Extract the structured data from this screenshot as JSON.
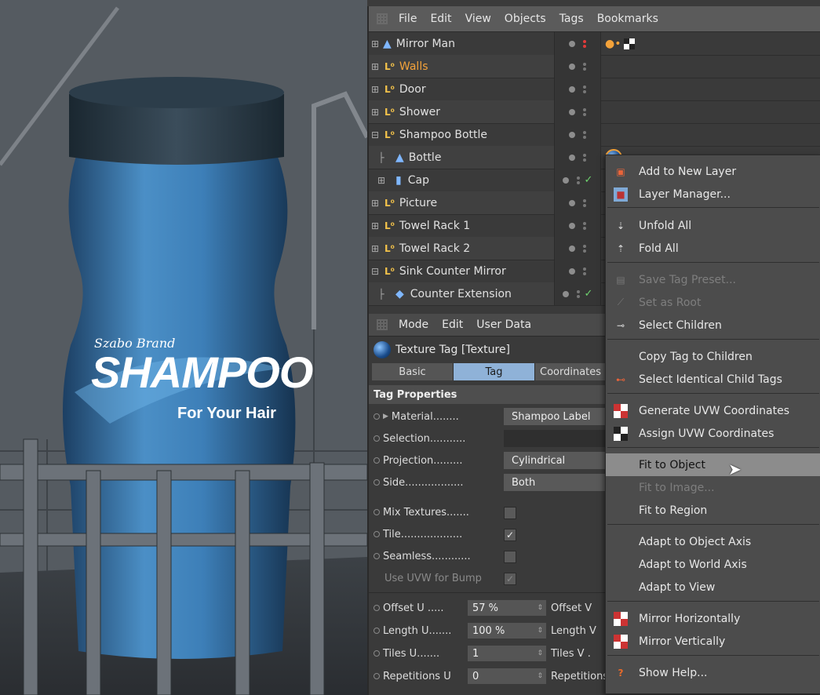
{
  "viewport": {
    "label_brand": "Szabo Brand",
    "label_product": "SHAMPOO",
    "label_tagline": "For Your Hair"
  },
  "object_manager": {
    "menu": [
      "File",
      "Edit",
      "View",
      "Objects",
      "Tags",
      "Bookmarks"
    ],
    "rows": [
      {
        "name": "Mirror Man",
        "indent": 0,
        "icon": "null-object-icon",
        "vis_red": true,
        "tags": [
          "material-tag-icon",
          "checker-tag-icon"
        ]
      },
      {
        "name": "Walls",
        "indent": 0,
        "icon": "layer-null-icon",
        "highlight": true
      },
      {
        "name": "Door",
        "indent": 0,
        "icon": "layer-null-icon"
      },
      {
        "name": "Shower",
        "indent": 0,
        "icon": "layer-null-icon"
      },
      {
        "name": "Shampoo Bottle",
        "indent": 0,
        "icon": "layer-null-icon",
        "expanded": true
      },
      {
        "name": "Bottle",
        "indent": 1,
        "icon": "null-object-icon",
        "tags": [
          "texture-tag-icon"
        ]
      },
      {
        "name": "Cap",
        "indent": 1,
        "icon": "cylinder-icon",
        "check": true
      },
      {
        "name": "Picture",
        "indent": 0,
        "icon": "layer-null-icon"
      },
      {
        "name": "Towel Rack 1",
        "indent": 0,
        "icon": "layer-null-icon"
      },
      {
        "name": "Towel Rack 2",
        "indent": 0,
        "icon": "layer-null-icon"
      },
      {
        "name": "Sink Counter Mirror",
        "indent": 0,
        "icon": "layer-null-icon",
        "expanded": true
      },
      {
        "name": "Counter Extension",
        "indent": 1,
        "icon": "cube-icon",
        "check": true
      }
    ]
  },
  "attribute_manager": {
    "menu": [
      "Mode",
      "Edit",
      "User Data"
    ],
    "title": "Texture Tag [Texture]",
    "tabs": [
      "Basic",
      "Tag",
      "Coordinates"
    ],
    "active_tab": "Tag",
    "section": "Tag Properties",
    "props": {
      "material_label": "Material........",
      "material_value": "Shampoo Label",
      "selection_label": "Selection...........",
      "selection_value": "",
      "projection_label": "Projection.........",
      "projection_value": "Cylindrical",
      "side_label": "Side..................",
      "side_value": "Both",
      "mix_label": "Mix Textures.......",
      "mix_checked": false,
      "tile_label": "Tile...................",
      "tile_checked": true,
      "seamless_label": "Seamless............",
      "seamless_checked": false,
      "uvwbump_label": "Use UVW for Bump",
      "uvwbump_checked": true
    },
    "numeric": {
      "offset_u_label": "Offset U .....",
      "offset_u_value": "57 %",
      "offset_v_label": "Offset V",
      "length_u_label": "Length U.......",
      "length_u_value": "100 %",
      "length_v_label": "Length V",
      "tiles_u_label": "Tiles U.......",
      "tiles_u_value": "1",
      "tiles_v_label": "Tiles V .",
      "rep_u_label": "Repetitions U",
      "rep_u_value": "0",
      "rep_v_label": "Repetitions V"
    }
  },
  "context_menu": {
    "items": {
      "add_to_new_layer": "Add to New Layer",
      "layer_manager": "Layer Manager...",
      "unfold_all": "Unfold All",
      "fold_all": "Fold All",
      "save_tag_preset": "Save Tag Preset...",
      "set_as_root": "Set as Root",
      "select_children": "Select Children",
      "copy_tag_to_children": "Copy Tag to Children",
      "select_identical_child_tags": "Select Identical Child Tags",
      "generate_uvw": "Generate UVW Coordinates",
      "assign_uvw": "Assign UVW Coordinates",
      "fit_to_object": "Fit to Object",
      "fit_to_image": "Fit to Image...",
      "fit_to_region": "Fit to Region",
      "adapt_object_axis": "Adapt to Object Axis",
      "adapt_world_axis": "Adapt to World Axis",
      "adapt_to_view": "Adapt to View",
      "mirror_horizontally": "Mirror Horizontally",
      "mirror_vertically": "Mirror Vertically",
      "show_help": "Show Help..."
    },
    "hovered": "Fit to Object",
    "disabled": [
      "Save Tag Preset...",
      "Set as Root",
      "Fit to Image..."
    ]
  },
  "colors": {
    "accent_tab": "#8fb2d8",
    "highlight_text": "#f3a23a",
    "check_green": "#6fd46f",
    "menu_hover": "#8c8c8c"
  }
}
